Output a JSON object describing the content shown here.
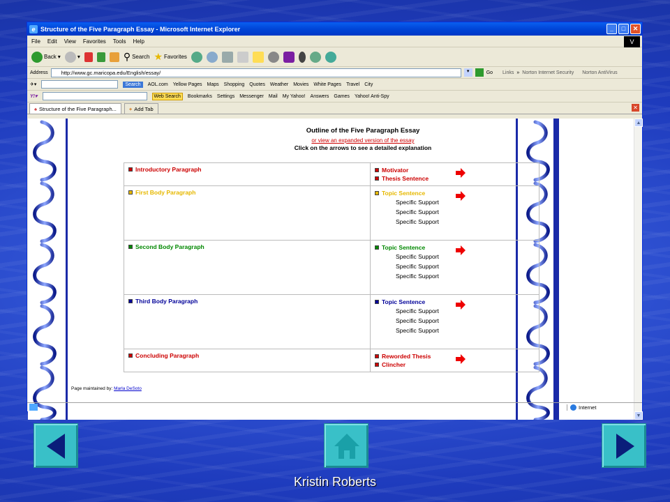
{
  "window": {
    "title": "Structure of the Five Paragraph Essay - Microsoft Internet Explorer",
    "v_badge": "V"
  },
  "menu": [
    "File",
    "Edit",
    "View",
    "Favorites",
    "Tools",
    "Help"
  ],
  "toolbar": {
    "back": "Back",
    "search": "Search",
    "favorites": "Favorites"
  },
  "address": {
    "label": "Address",
    "url": "http://www.gc.maricopa.edu/English/essay/",
    "go": "Go",
    "links": "Links",
    "norton_security": "Norton Internet Security",
    "norton_av": "Norton AntiVirus"
  },
  "aolbar": {
    "search_btn": "Search",
    "aol": "AOL.com",
    "items": [
      "Yellow Pages",
      "Maps",
      "Shopping",
      "Quotes",
      "Weather",
      "Movies",
      "White Pages",
      "Travel",
      "City"
    ]
  },
  "yahoobar": {
    "web_search": "Web Search",
    "items": [
      "Bookmarks",
      "Settings",
      "Messenger",
      "Mail",
      "My Yahoo!",
      "Answers",
      "Games",
      "Yahoo! Anti-Spy"
    ]
  },
  "tabs": {
    "active": "Structure of the Five Paragraph...",
    "add": "Add Tab"
  },
  "page": {
    "heading": "Outline of the Five Paragraph Essay",
    "link": "or view an expanded version of the essay",
    "instruction": "Click on the arrows to see a detailed explanation",
    "rows": [
      {
        "left": "Introductory Paragraph",
        "color": "#cc0000",
        "right": [
          "Motivator",
          "Thesis Sentence"
        ],
        "supports": []
      },
      {
        "left": "First Body Paragraph",
        "color": "#e6b800",
        "right": [
          "Topic Sentence"
        ],
        "supports": [
          "Specific Support",
          "Specific Support",
          "Specific Support"
        ]
      },
      {
        "left": "Second Body Paragraph",
        "color": "#008800",
        "right": [
          "Topic Sentence"
        ],
        "supports": [
          "Specific Support",
          "Specific Support",
          "Specific Support"
        ]
      },
      {
        "left": "Third Body Paragraph",
        "color": "#000099",
        "right": [
          "Topic Sentence"
        ],
        "supports": [
          "Specific Support",
          "Specific Support",
          "Specific Support"
        ]
      },
      {
        "left": "Concluding Paragraph",
        "color": "#cc0000",
        "right": [
          "Reworded Thesis",
          "Clincher"
        ],
        "supports": []
      }
    ],
    "footer_label": "Page maintained by:",
    "footer_name": "Marla DeSoto"
  },
  "status": {
    "zone": "Internet"
  },
  "slide": {
    "author": "Kristin Roberts"
  }
}
